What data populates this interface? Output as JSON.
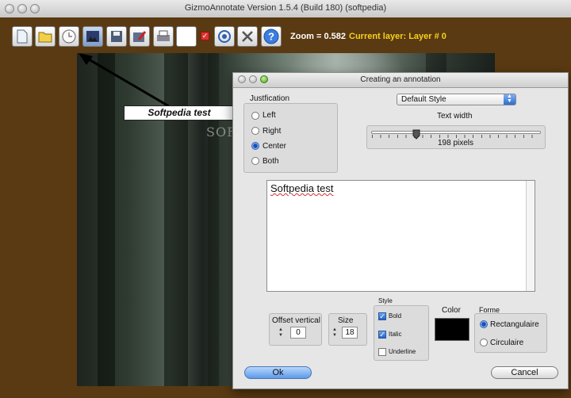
{
  "window": {
    "title": "GizmoAnnotate  Version 1.5.4 (Build 180) (softpedia)"
  },
  "toolbar": {
    "icons": [
      "new-document-icon",
      "open-folder-icon",
      "clock-icon",
      "image-icon",
      "save-icon",
      "edit-image-icon",
      "print-icon",
      "blank-icon",
      "checkbox-icon",
      "layers-icon",
      "tools-icon",
      "help-icon"
    ],
    "zoom_text": "Zoom = 0.582",
    "layer_text": "Current layer: Layer # 0"
  },
  "canvas": {
    "annotation_text": "Softpedia test",
    "watermark_text": "SOFTPEDIA"
  },
  "dialog": {
    "title": "Creating an annotation",
    "justification": {
      "legend": "Justfication",
      "options": [
        "Left",
        "Right",
        "Center",
        "Both"
      ],
      "selected": "Center"
    },
    "style_select": "Default Style",
    "text_width": {
      "label": "Text width",
      "value": 198,
      "unit_text": "198  pixels"
    },
    "text_content": "Softpedia test",
    "offset_vertical": {
      "label": "Offset vertical",
      "value": "0"
    },
    "size": {
      "label": "Size",
      "value": "18"
    },
    "style_group": {
      "legend": "Style",
      "bold": {
        "label": "Bold",
        "checked": true
      },
      "italic": {
        "label": "Italic",
        "checked": true
      },
      "underline": {
        "label": "Underline",
        "checked": false
      }
    },
    "color": {
      "label": "Color",
      "value": "#000000"
    },
    "forme": {
      "legend": "Forme",
      "options": [
        "Rectangulaire",
        "Circulaire"
      ],
      "selected": "Rectangulaire"
    },
    "ok_label": "Ok",
    "cancel_label": "Cancel"
  }
}
